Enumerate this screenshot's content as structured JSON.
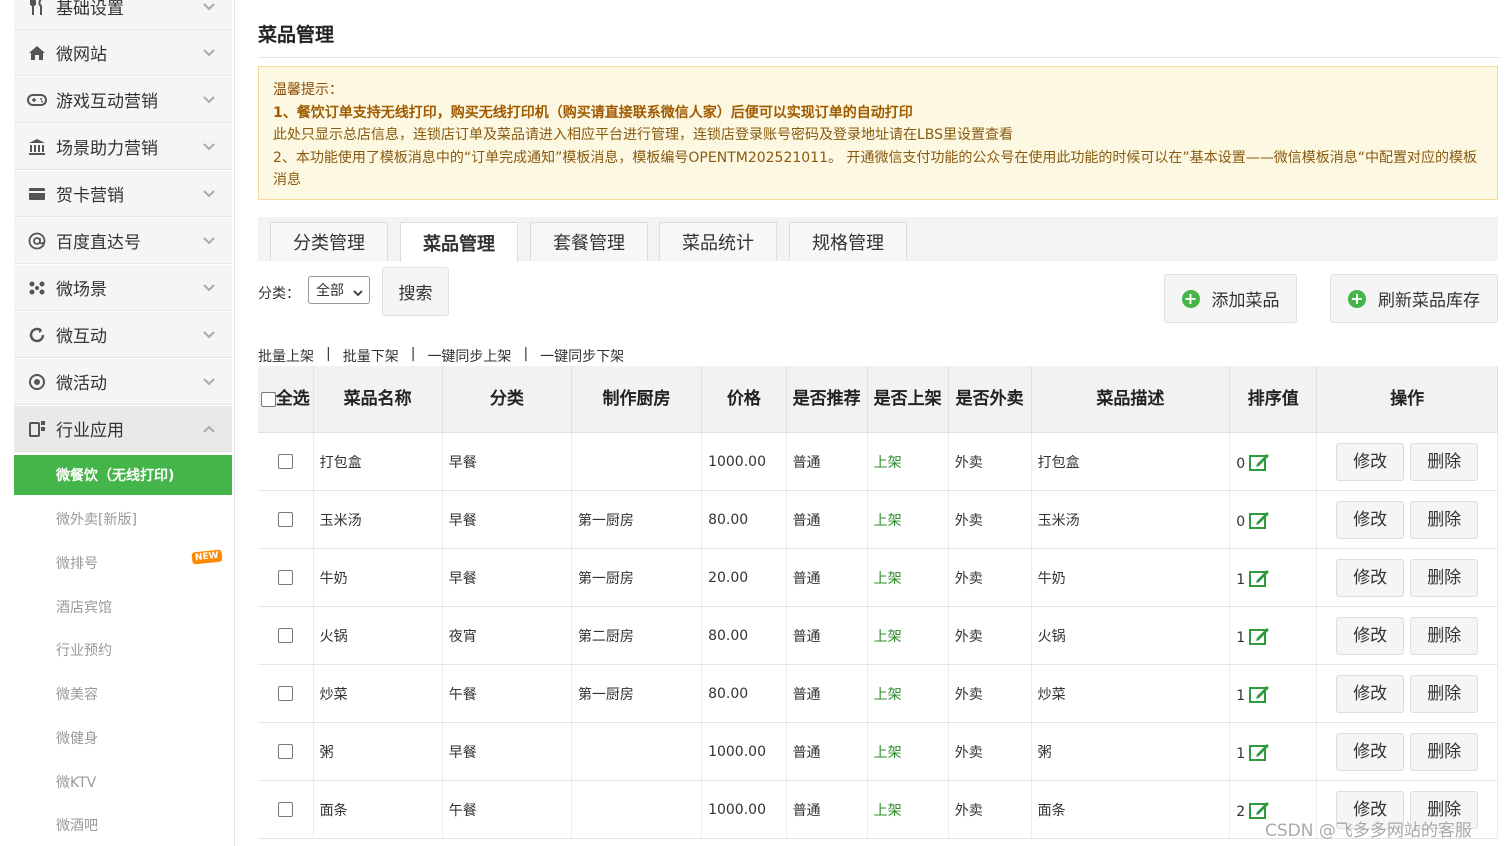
{
  "sidebar": {
    "items": [
      {
        "label": "基础设置",
        "icon": "fork-knife-icon"
      },
      {
        "label": "微网站",
        "icon": "home-icon"
      },
      {
        "label": "游戏互动营销",
        "icon": "gamepad-icon"
      },
      {
        "label": "场景助力营销",
        "icon": "bank-icon"
      },
      {
        "label": "贺卡营销",
        "icon": "card-icon"
      },
      {
        "label": "百度直达号",
        "icon": "at-icon"
      },
      {
        "label": "微场景",
        "icon": "dots-icon"
      },
      {
        "label": "微互动",
        "icon": "refresh-icon"
      },
      {
        "label": "微活动",
        "icon": "activity-icon"
      },
      {
        "label": "行业应用",
        "icon": "app-icon"
      }
    ],
    "subitems": [
      {
        "label": "微餐饮（无线打印)"
      },
      {
        "label": "微外卖[新版]",
        "badge": "NEW"
      },
      {
        "label": "微排号"
      },
      {
        "label": "酒店宾馆"
      },
      {
        "label": "行业预约"
      },
      {
        "label": "微美容"
      },
      {
        "label": "微健身"
      },
      {
        "label": "微KTV"
      },
      {
        "label": "微酒吧"
      }
    ]
  },
  "page": {
    "title": "菜品管理"
  },
  "notice": {
    "title": "温馨提示：",
    "line1": "1、餐饮订单支持无线打印，购买无线打印机（购买请直接联系微信人家）后便可以实现订单的自动打印",
    "line2": "此处只显示总店信息，连锁店订单及菜品请进入相应平台进行管理，连锁店登录账号密码及登录地址请在LBS里设置查看",
    "line3": "2、本功能使用了模板消息中的“订单完成通知”模板消息，模板编号OPENTM202521011。 开通微信支付功能的公众号在使用此功能的时候可以在”基本设置——微信模板消息“中配置对应的模板消息"
  },
  "tabs": [
    "分类管理",
    "菜品管理",
    "套餐管理",
    "菜品统计",
    "规格管理"
  ],
  "filter": {
    "label": "分类：",
    "selected": "全部",
    "search": "搜索"
  },
  "actions": {
    "add": "添加菜品",
    "refresh": "刷新菜品库存"
  },
  "batch": {
    "on": "批量上架",
    "off": "批量下架",
    "sync_on": "一键同步上架",
    "sync_off": "一键同步下架"
  },
  "table": {
    "headers": {
      "select_all": "全选",
      "name": "菜品名称",
      "category": "分类",
      "kitchen": "制作厨房",
      "price": "价格",
      "recommend": "是否推荐",
      "on_shelf": "是否上架",
      "takeout": "是否外卖",
      "desc": "菜品描述",
      "sort": "排序值",
      "ops": "操作"
    },
    "edit_label": "修改",
    "delete_label": "删除",
    "rows": [
      {
        "name": "打包盒",
        "category": "早餐",
        "kitchen": "",
        "price": "1000.00",
        "recommend": "普通",
        "on_shelf": "上架",
        "takeout": "外卖",
        "desc": "打包盒",
        "sort": "0"
      },
      {
        "name": "玉米汤",
        "category": "早餐",
        "kitchen": "第一厨房",
        "price": "80.00",
        "recommend": "普通",
        "on_shelf": "上架",
        "takeout": "外卖",
        "desc": "玉米汤",
        "sort": "0"
      },
      {
        "name": "牛奶",
        "category": "早餐",
        "kitchen": "第一厨房",
        "price": "20.00",
        "recommend": "普通",
        "on_shelf": "上架",
        "takeout": "外卖",
        "desc": "牛奶",
        "sort": "1"
      },
      {
        "name": "火锅",
        "category": "夜宵",
        "kitchen": "第二厨房",
        "price": "80.00",
        "recommend": "普通",
        "on_shelf": "上架",
        "takeout": "外卖",
        "desc": "火锅",
        "sort": "1"
      },
      {
        "name": "炒菜",
        "category": "午餐",
        "kitchen": "第一厨房",
        "price": "80.00",
        "recommend": "普通",
        "on_shelf": "上架",
        "takeout": "外卖",
        "desc": "炒菜",
        "sort": "1"
      },
      {
        "name": "粥",
        "category": "早餐",
        "kitchen": "",
        "price": "1000.00",
        "recommend": "普通",
        "on_shelf": "上架",
        "takeout": "外卖",
        "desc": "粥",
        "sort": "1"
      },
      {
        "name": "面条",
        "category": "午餐",
        "kitchen": "",
        "price": "1000.00",
        "recommend": "普通",
        "on_shelf": "上架",
        "takeout": "外卖",
        "desc": "面条",
        "sort": "2"
      }
    ]
  },
  "watermark": "CSDN @飞多多网站的客服",
  "colors": {
    "accent": "#44b549",
    "notice_bg": "#fdf8e1",
    "notice_text": "#8a4b08",
    "on_shelf": "#2e8b2e"
  }
}
